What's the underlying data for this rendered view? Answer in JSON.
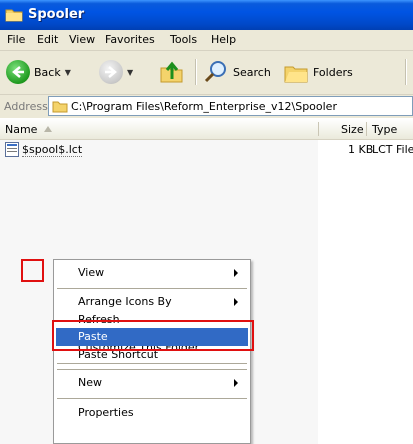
{
  "window": {
    "title": "Spooler"
  },
  "menubar": [
    "File",
    "Edit",
    "View",
    "Favorites",
    "Tools",
    "Help"
  ],
  "toolbar": {
    "back_label": "Back",
    "search_label": "Search",
    "folders_label": "Folders"
  },
  "addressbar": {
    "label": "Address",
    "path": "C:\\Program Files\\Reform_Enterprise_v12\\Spooler"
  },
  "columns": {
    "name": "Name",
    "size": "Size",
    "type": "Type"
  },
  "files": [
    {
      "name": "$spool$.lct",
      "size": "1 KB",
      "type": "LCT File"
    }
  ],
  "context_menu": {
    "view": "View",
    "arrange": "Arrange Icons By",
    "refresh": "Refresh",
    "customize": "Customize This Folder...",
    "paste": "Paste",
    "paste_shortcut": "Paste Shortcut",
    "new": "New",
    "properties": "Properties"
  },
  "colors": {
    "title_bar": "#0054e3",
    "highlight": "#316ac5",
    "annotation": "#e01010"
  }
}
